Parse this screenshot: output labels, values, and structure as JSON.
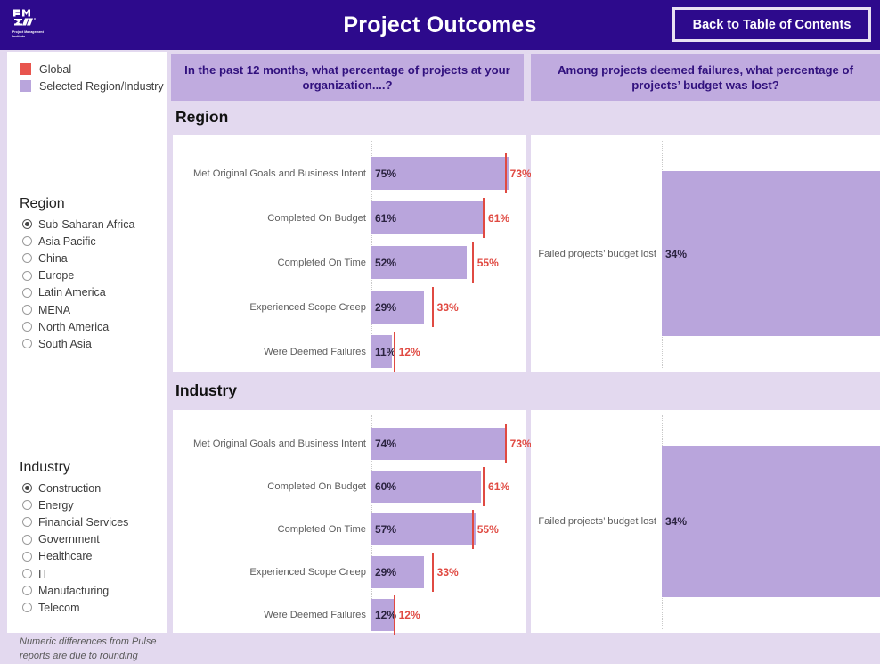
{
  "header": {
    "title": "Project Outcomes",
    "logo_name": "pmi-logo",
    "logo_subtext": "Project Management Institute.",
    "back_button": "Back to Table of Contents"
  },
  "legend": {
    "items": [
      {
        "label": "Global",
        "color": "#e8554e",
        "swatch_name": "legend-swatch-global"
      },
      {
        "label": "Selected Region/Industry",
        "color": "#b9a5dc",
        "swatch_name": "legend-swatch-selected"
      }
    ]
  },
  "filters": {
    "region": {
      "title": "Region",
      "selected": "Sub-Saharan Africa",
      "options": [
        "Sub-Saharan Africa",
        "Asia Pacific",
        "China",
        "Europe",
        "Latin America",
        "MENA",
        "North America",
        "South Asia"
      ]
    },
    "industry": {
      "title": "Industry",
      "selected": "Construction",
      "options": [
        "Construction",
        "Energy",
        "Financial Services",
        "Government",
        "Healthcare",
        "IT",
        "Manufacturing",
        "Telecom"
      ]
    },
    "footnote": "Numeric differences from Pulse reports are due to rounding"
  },
  "questions": {
    "left": "In the past 12 months, what percentage of projects at your organization....?",
    "right": "Among projects deemed failures, what percentage of projects’ budget was lost?"
  },
  "sections": {
    "region": "Region",
    "industry": "Industry"
  },
  "chart_data": [
    {
      "id": "region-outcomes",
      "type": "bar",
      "orientation": "horizontal",
      "title": "Region",
      "subtitle": "In the past 12 months, what percentage of projects at your organization....?",
      "xlabel": "",
      "ylabel": "",
      "xlim": [
        0,
        100
      ],
      "grid": false,
      "legend_position": "top-left-sidebar",
      "categories": [
        "Met Original Goals and Business Intent",
        "Completed On Budget",
        "Completed On Time",
        "Experienced Scope Creep",
        "Were Deemed Failures"
      ],
      "series": [
        {
          "name": "Selected Region/Industry",
          "color": "#b9a5dc",
          "type": "bar",
          "values": [
            75,
            61,
            52,
            29,
            11
          ],
          "labels": [
            "75%",
            "61%",
            "52%",
            "29%",
            "11%"
          ]
        },
        {
          "name": "Global",
          "color": "#e04a42",
          "type": "reference-line",
          "values": [
            73,
            61,
            55,
            33,
            12
          ],
          "labels": [
            "73%",
            "61%",
            "55%",
            "33%",
            "12%"
          ]
        }
      ]
    },
    {
      "id": "region-budget-lost",
      "type": "bar",
      "orientation": "horizontal",
      "title": "Region",
      "subtitle": "Among projects deemed failures, what percentage of projects’ budget was lost?",
      "xlim": [
        0,
        100
      ],
      "grid": false,
      "categories": [
        "Failed projects’ budget lost"
      ],
      "series": [
        {
          "name": "Selected Region/Industry",
          "color": "#b9a5dc",
          "type": "bar",
          "values": [
            34
          ],
          "labels": [
            "34%"
          ]
        },
        {
          "name": "Global",
          "color": "#e04a42",
          "type": "reference-line",
          "values": [
            34
          ],
          "labels": [
            "34%"
          ]
        }
      ]
    },
    {
      "id": "industry-outcomes",
      "type": "bar",
      "orientation": "horizontal",
      "title": "Industry",
      "subtitle": "In the past 12 months, what percentage of projects at your organization....?",
      "xlim": [
        0,
        100
      ],
      "grid": false,
      "categories": [
        "Met Original Goals and Business Intent",
        "Completed On Budget",
        "Completed On Time",
        "Experienced Scope Creep",
        "Were Deemed Failures"
      ],
      "series": [
        {
          "name": "Selected Region/Industry",
          "color": "#b9a5dc",
          "type": "bar",
          "values": [
            74,
            60,
            57,
            29,
            12
          ],
          "labels": [
            "74%",
            "60%",
            "57%",
            "29%",
            "12%"
          ]
        },
        {
          "name": "Global",
          "color": "#e04a42",
          "type": "reference-line",
          "values": [
            73,
            61,
            55,
            33,
            12
          ],
          "labels": [
            "73%",
            "61%",
            "55%",
            "33%",
            "12%"
          ]
        }
      ]
    },
    {
      "id": "industry-budget-lost",
      "type": "bar",
      "orientation": "horizontal",
      "title": "Industry",
      "subtitle": "Among projects deemed failures, what percentage of projects’ budget was lost?",
      "xlim": [
        0,
        100
      ],
      "grid": false,
      "categories": [
        "Failed projects’ budget lost"
      ],
      "series": [
        {
          "name": "Selected Region/Industry",
          "color": "#b9a5dc",
          "type": "bar",
          "values": [
            34
          ],
          "labels": [
            "34%"
          ]
        },
        {
          "name": "Global",
          "color": "#e04a42",
          "type": "reference-line",
          "values": [
            34
          ],
          "labels": [
            "34%"
          ]
        }
      ]
    }
  ]
}
